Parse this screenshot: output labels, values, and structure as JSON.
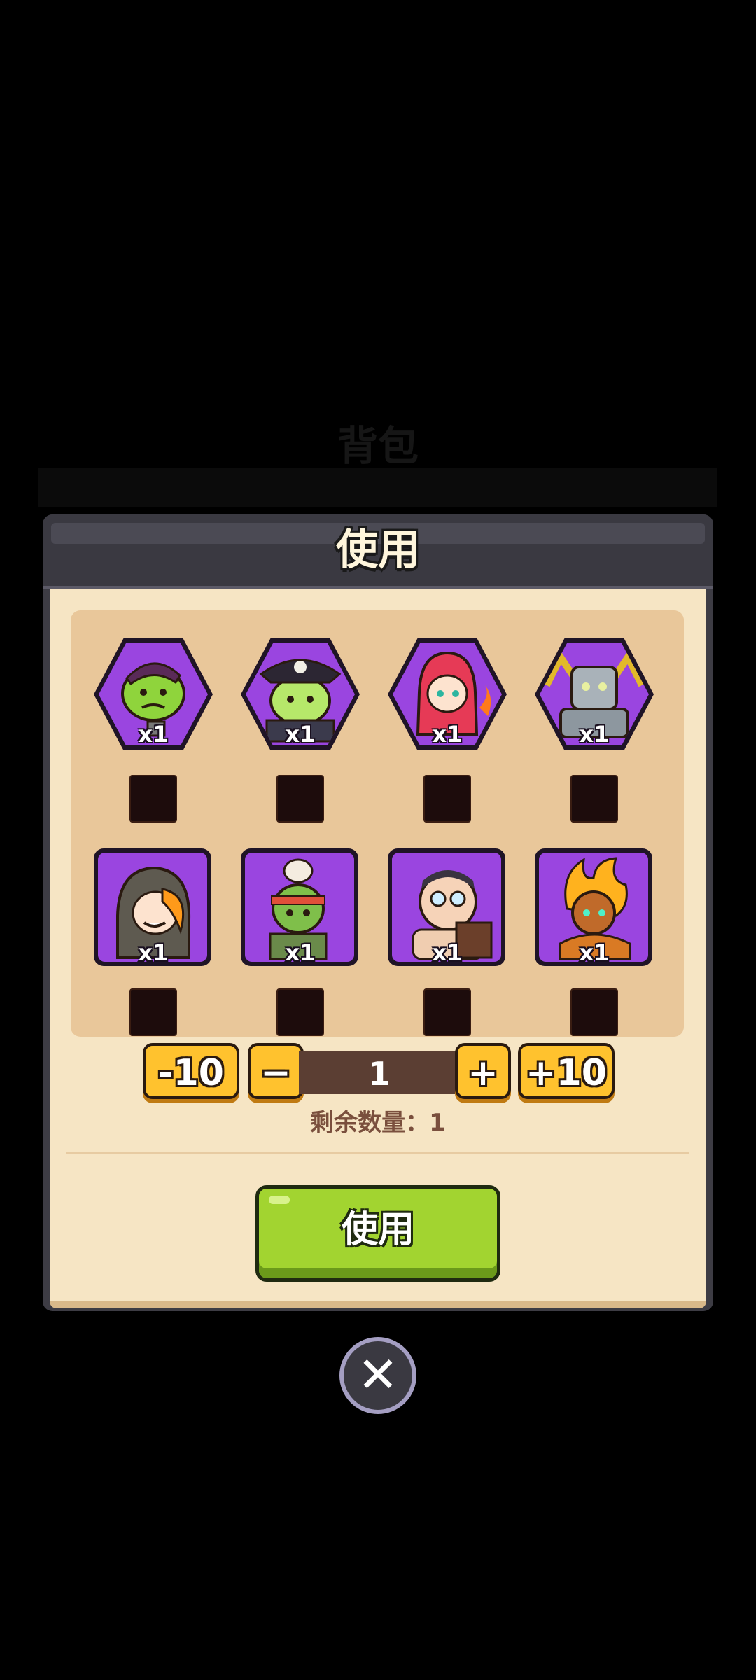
{
  "background": {
    "title": "背包"
  },
  "dialog": {
    "title": "使用",
    "items": [
      {
        "name": "orc-warrior",
        "count": "x1",
        "frame": "hex"
      },
      {
        "name": "pirate-goblin",
        "count": "x1",
        "frame": "hex"
      },
      {
        "name": "red-hood-mage",
        "count": "x1",
        "frame": "hex"
      },
      {
        "name": "stone-golem",
        "count": "x1",
        "frame": "hex"
      },
      {
        "name": "hooded-rogue",
        "count": "x1",
        "frame": "square"
      },
      {
        "name": "goblin-chef",
        "count": "x1",
        "frame": "square"
      },
      {
        "name": "bald-brawler",
        "count": "x1",
        "frame": "square"
      },
      {
        "name": "fire-spirit",
        "count": "x1",
        "frame": "square"
      }
    ],
    "stepper": {
      "minus10_label": "-10",
      "minus_label": "−",
      "quantity": "1",
      "plus_label": "+",
      "plus10_label": "+10"
    },
    "remaining_label": "剩余数量：1",
    "use_button_label": "使用"
  },
  "close_icon": "close-icon"
}
